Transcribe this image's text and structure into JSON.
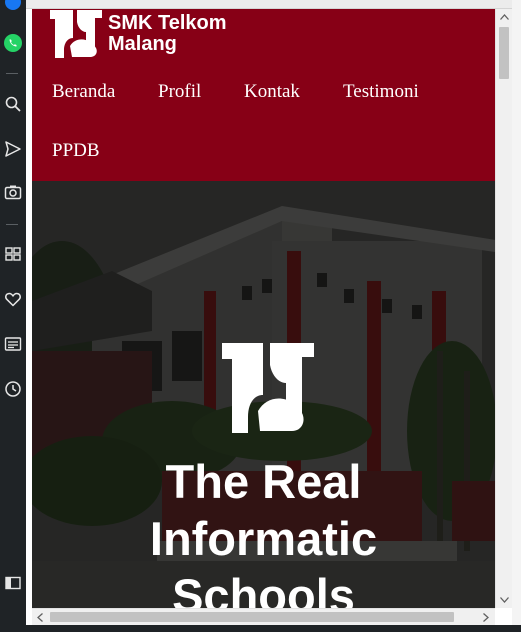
{
  "sidebar": {
    "icons": [
      "messenger-icon",
      "whatsapp-icon",
      "search-icon",
      "send-icon",
      "camera-icon",
      "apps-icon",
      "heart-icon",
      "news-icon",
      "history-icon",
      "sidebar-toggle-icon"
    ]
  },
  "header": {
    "brand_line1": "SMK Telkom",
    "brand_line2": "Malang",
    "background_color": "#870016"
  },
  "nav": {
    "items": [
      "Beranda",
      "Profil",
      "Kontak",
      "Testimoni",
      "PPDB"
    ]
  },
  "hero": {
    "title_line1": "The Real",
    "title_line2": "Informatic",
    "title_line3": "Schools"
  }
}
